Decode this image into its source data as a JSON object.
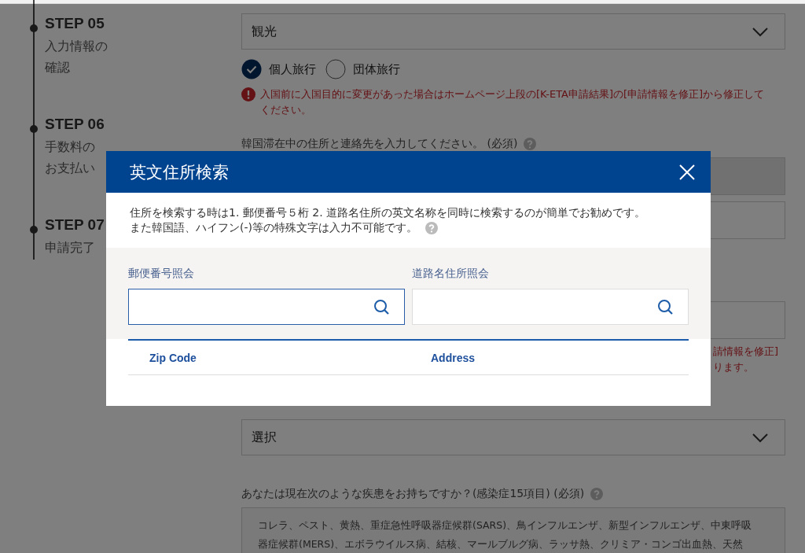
{
  "steps": [
    {
      "title": "STEP 05",
      "lines": [
        "入力情報の",
        "確認"
      ]
    },
    {
      "title": "STEP 06",
      "lines": [
        "手数料の",
        "お支払い"
      ]
    },
    {
      "title": "STEP 07",
      "lines": [
        "申請完了"
      ]
    }
  ],
  "purpose_select": {
    "value": "観光"
  },
  "travel_type": [
    {
      "label": "個人旅行",
      "selected": true
    },
    {
      "label": "団体旅行",
      "selected": false
    }
  ],
  "purpose_notice": "入国前に入国目的に変更があった場合はホームページ上段の[K-ETA申請結果]の[申請情報を修正]から修正してください。",
  "address_label": "韓国滞在中の住所と連絡先を入力してください。 (必須)",
  "address_fields": [
    {
      "disabled": true
    },
    {
      "disabled": false
    }
  ],
  "contact_field": {
    "disabled": false
  },
  "contact_notice_fragments": [
    "請情報を修正]",
    "ります。"
  ],
  "occupation_select": {
    "value": "選択"
  },
  "disease_label": "あなたは現在次のような疾患をお持ちですか？(感染症15項目) (必須)",
  "disease_lines": [
    "コレラ、ペスト、黄熱、重症急性呼吸器症候群(SARS)、鳥インフルエンザ、新型インフルエンザ、中東呼吸",
    "器症候群(MERS)、エボラウイルス病、結核、マールブルグ病、ラッサ熱、クリミア・コンゴ出血熱、天然"
  ],
  "modal": {
    "title": "英文住所検索",
    "description_lines": [
      "住所を検索する時は1. 郵便番号５桁 2. 道路名住所の英文名称を同時に検索するのが簡単でお勧めです。",
      "また韓国語、ハイフン(-)等の特殊文字は入力不可能です。"
    ],
    "search_fields": [
      {
        "label": "郵便番号照会",
        "focused": true
      },
      {
        "label": "道路名住所照会",
        "focused": false
      }
    ],
    "table": {
      "columns": [
        "Zip Code",
        "Address"
      ]
    }
  }
}
